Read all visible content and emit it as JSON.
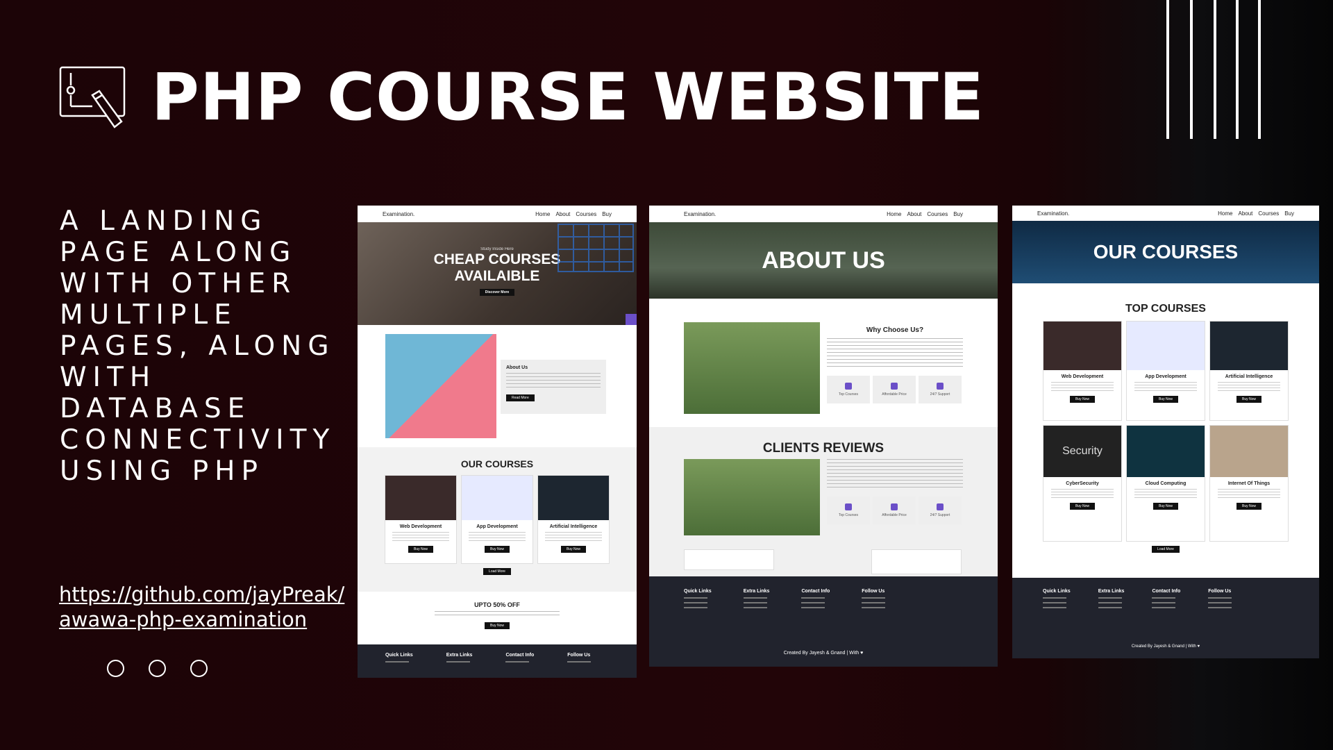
{
  "title": "PHP COURSE WEBSITE",
  "tagline_lines": [
    "A LANDING",
    "PAGE ALONG",
    "WITH OTHER",
    "MULTIPLE",
    "PAGES, ALONG",
    "WITH DATABASE",
    "CONNECTIVITY",
    "USING PHP"
  ],
  "link_lines": [
    "https://github.com/jayPreak/",
    "awawa-php-examination"
  ],
  "icons": {
    "title": "screen-pen-icon",
    "dots": "circle-icon"
  },
  "screens": {
    "brand": "Examination.",
    "nav": [
      "Home",
      "About",
      "Courses",
      "Buy"
    ],
    "home": {
      "hero_small": "Study Inside Here",
      "hero_title_1": "CHEAP COURSES",
      "hero_title_2": "AVAILAIBLE",
      "hero_button": "Discover More",
      "about_heading": "About Us",
      "read_more": "Read More",
      "courses_heading": "OUR COURSES",
      "courses": [
        "Web Development",
        "App Development",
        "Artificial Intelligence"
      ],
      "buy_now": "Buy Now",
      "load_more": "Load More",
      "offer": "UPTO 50% OFF",
      "footer": [
        "Quick Links",
        "Extra Links",
        "Contact Info",
        "Follow Us"
      ]
    },
    "about": {
      "hero_title": "ABOUT US",
      "why": "Why Choose Us?",
      "tiles": [
        "Top Courses",
        "Affordable Price",
        "24/7 Support"
      ],
      "reviews": "CLIENTS REVIEWS",
      "footer": [
        "Quick Links",
        "Extra Links",
        "Contact Info",
        "Follow Us"
      ],
      "credit": "Created By Jayesh & Gnand | With ♥"
    },
    "courses": {
      "hero_title": "OUR COURSES",
      "top": "TOP COURSES",
      "cards": [
        "Web Development",
        "App Development",
        "Artificial Intelligence",
        "CyberSecurity",
        "Cloud Computing",
        "Internet Of Things"
      ],
      "security_word": "Security",
      "footer": [
        "Quick Links",
        "Extra Links",
        "Contact Info",
        "Follow Us"
      ],
      "credit": "Created By Jayesh & Gnand | With ♥"
    }
  },
  "colors": {
    "background": "#1c0407",
    "accent": "#6b4fc8",
    "footer": "#21232d"
  }
}
